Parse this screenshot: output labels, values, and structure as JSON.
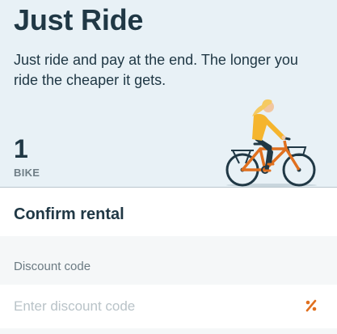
{
  "hero": {
    "title": "Just Ride",
    "description": "Just ride and pay at the end. The longer you ride the cheaper it gets.",
    "bike_count": "1",
    "bike_unit": "BIKE",
    "illustration_icon": "person-riding-bike-icon"
  },
  "confirm": {
    "title": "Confirm rental"
  },
  "discount": {
    "label": "Discount code",
    "value": "",
    "placeholder": "Enter discount code",
    "icon": "percent-icon"
  },
  "colors": {
    "hero_background": "#e8f1f6",
    "accent_orange": "#e0701f",
    "text_dark": "#203845",
    "text_muted": "#6b7a82",
    "placeholder": "#b9c3c8"
  }
}
